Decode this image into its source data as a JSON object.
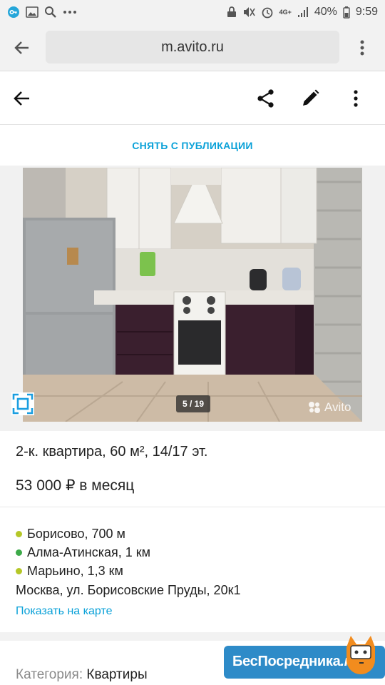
{
  "status_bar": {
    "battery": "40%",
    "time": "9:59",
    "network": "4G+"
  },
  "browser": {
    "url": "m.avito.ru"
  },
  "listing": {
    "unpublish_label": "СНЯТЬ С ПУБЛИКАЦИИ",
    "photo_counter": "5 / 19",
    "watermark": "Avito",
    "title": "2-к. квартира, 60 м², 14/17 эт.",
    "price": "53 000 ₽ в месяц",
    "metro": [
      {
        "name": "Борисово, 700 м",
        "color": "#b5c727"
      },
      {
        "name": "Алма-Атинская, 1 км",
        "color": "#3daa49"
      },
      {
        "name": "Марьино, 1,3 км",
        "color": "#b5c727"
      }
    ],
    "address": "Москва, ул. Борисовские Пруды, 20к1",
    "map_link": "Показать на карте",
    "category_label": "Категория:",
    "category_value": "Квартиры"
  },
  "promo": {
    "text": "БесПосредника",
    "suffix": ".ru"
  },
  "colors": {
    "accent": "#0aa1d8",
    "promo_bg": "#2e8bc8"
  }
}
